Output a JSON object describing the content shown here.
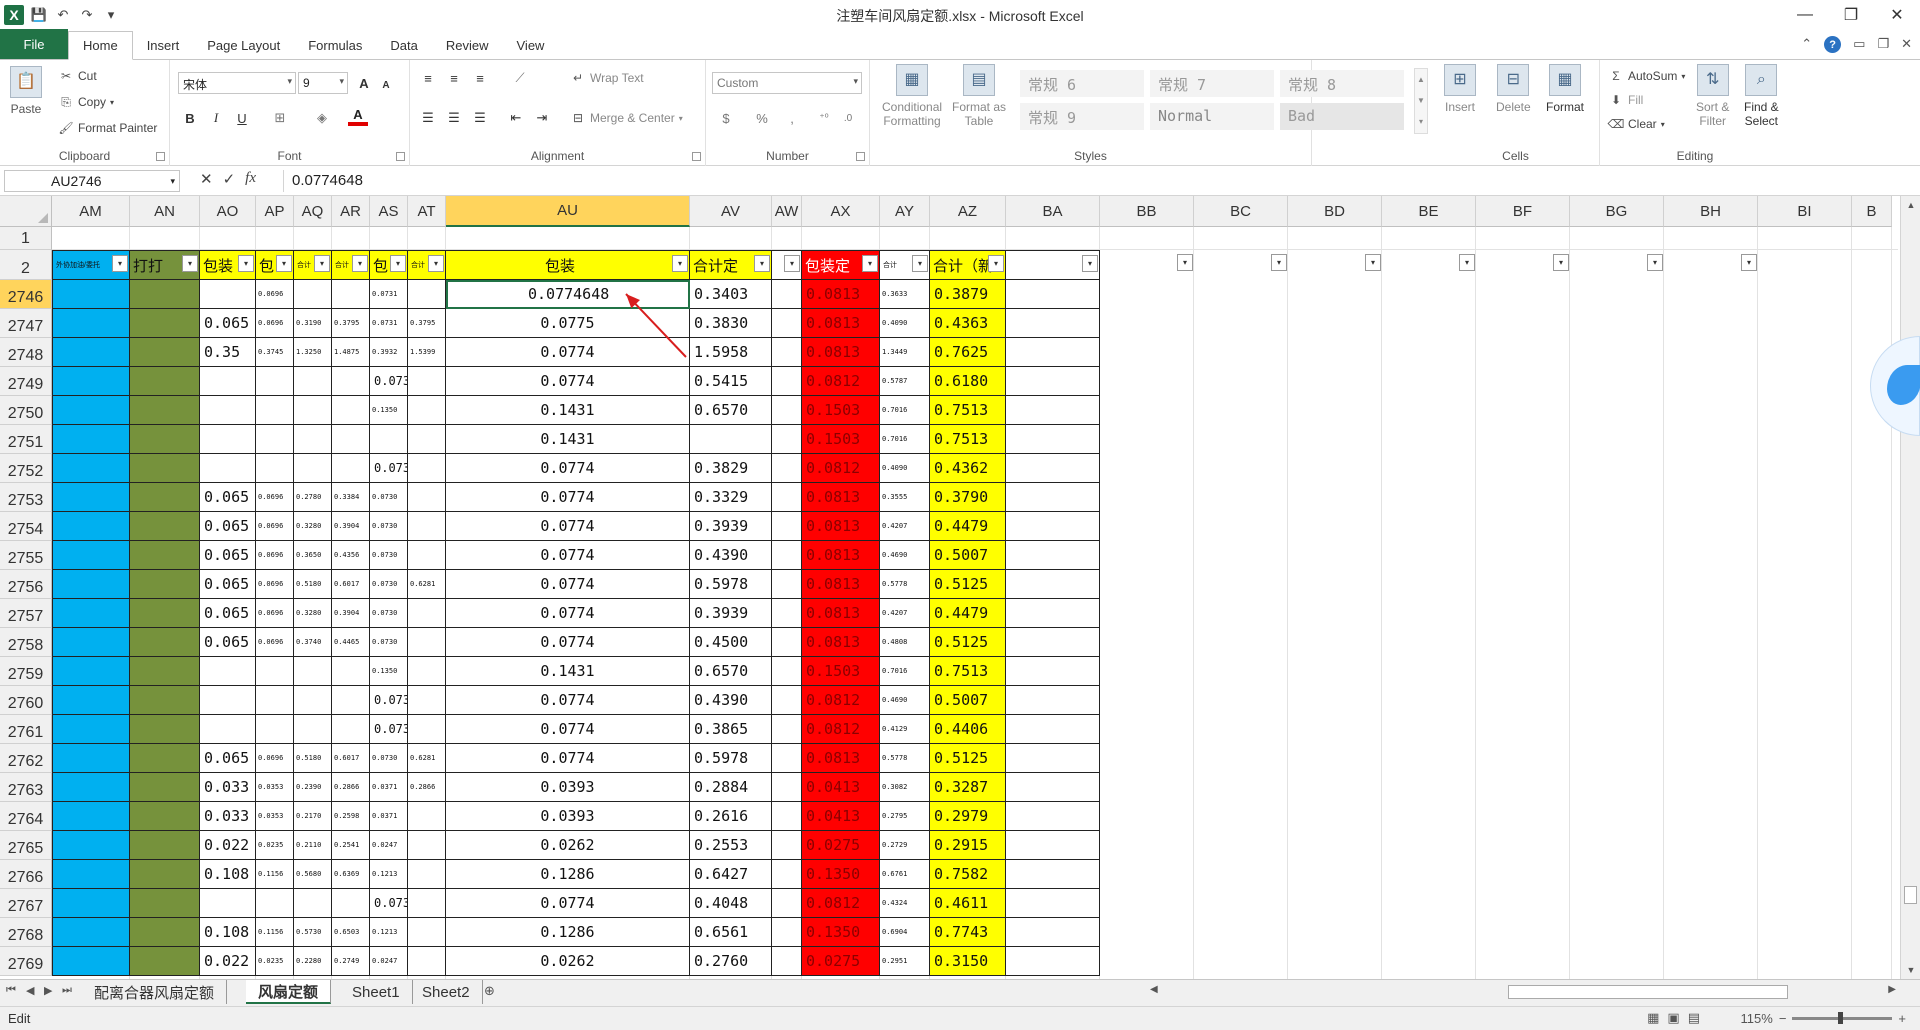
{
  "window": {
    "title": "注塑车间风扇定额.xlsx - Microsoft Excel",
    "minimize": "—",
    "restore": "❐",
    "close": "✕"
  },
  "tabs": [
    "File",
    "Home",
    "Insert",
    "Page Layout",
    "Formulas",
    "Data",
    "Review",
    "View"
  ],
  "active_tab": "Home",
  "ribbon": {
    "clipboard": {
      "label": "Clipboard",
      "paste": "Paste",
      "cut": "Cut",
      "copy": "Copy",
      "format_painter": "Format Painter"
    },
    "font": {
      "label": "Font",
      "name": "宋体",
      "size": "9",
      "bold": "B",
      "italic": "I",
      "underline": "U",
      "grow": "A",
      "shrink": "A"
    },
    "alignment": {
      "label": "Alignment",
      "wrap_text": "Wrap Text",
      "merge_center": "Merge & Center"
    },
    "number": {
      "label": "Number",
      "format": "Custom",
      "currency": "$",
      "percent": "%",
      "comma": ",",
      "inc_dec": "⁺⁰",
      "dec_dec": ".0"
    },
    "styles": {
      "label": "Styles",
      "conditional": [
        "Conditional",
        "Formatting"
      ],
      "format_as": [
        "Format as",
        "Table"
      ],
      "cells": [
        "常规 6",
        "常规 7",
        "常规 8",
        "常规 9",
        "Normal",
        "Bad"
      ]
    },
    "cells": {
      "label": "Cells",
      "insert": "Insert",
      "delete": "Delete",
      "format": "Format"
    },
    "editing": {
      "label": "Editing",
      "autosum": "AutoSum",
      "fill": "Fill",
      "clear": "Clear",
      "sort": [
        "Sort &",
        "Filter"
      ],
      "find": [
        "Find &",
        "Select"
      ]
    }
  },
  "formula_bar": {
    "name_box": "AU2746",
    "cancel": "✕",
    "enter": "✓",
    "fx": "fx",
    "value": "0.0774648"
  },
  "columns": [
    "AM",
    "AN",
    "AO",
    "AP",
    "AQ",
    "AR",
    "AS",
    "AT",
    "AU",
    "AV",
    "AW",
    "AX",
    "AY",
    "AZ",
    "BA",
    "BB",
    "BC",
    "BD",
    "BE",
    "BF",
    "BG",
    "BH",
    "BI",
    "B"
  ],
  "selected_column": "AU",
  "header_row": {
    "row1": "1",
    "row2": "2",
    "AM": "外协加油/委托",
    "AN": "打打",
    "AO": "包装",
    "AP": "包",
    "AQ": "合计",
    "AR": "合计",
    "AS": "包",
    "AT": "合计",
    "AU": "包装",
    "AV": "合计定",
    "AW": "",
    "AX": "包装定",
    "AY": "合计",
    "AZ": "合计（新",
    "BA": ""
  },
  "rows": [
    {
      "n": "2746",
      "AO": "",
      "AP": "0.0696",
      "AQ": "",
      "AR": "",
      "AS": "0.0731",
      "AT": "",
      "AU": "0.0774648",
      "AV": "0.3403",
      "AX": "0.0813",
      "AY": "0.3633",
      "AZ": "0.3879"
    },
    {
      "n": "2747",
      "AO": "0.065",
      "AP": "0.0696",
      "AQ": "0.3190",
      "AR": "0.3795",
      "AS": "0.0731",
      "AT": "0.3795",
      "AU": "0.0775",
      "AV": "0.3830",
      "AX": "0.0813",
      "AY": "0.4090",
      "AZ": "0.4363"
    },
    {
      "n": "2748",
      "AO": "0.35",
      "AP": "0.3745",
      "AQ": "1.3250",
      "AR": "1.4875",
      "AS": "0.3932",
      "AT": "1.5399",
      "AU": "0.0774",
      "AV": "1.5958",
      "AX": "0.0813",
      "AY": "1.3449",
      "AZ": "0.7625"
    },
    {
      "n": "2749",
      "AO": "",
      "AP": "",
      "AQ": "",
      "AR": "",
      "AS": "0.073",
      "AT": "",
      "AU": "0.0774",
      "AV": "0.5415",
      "AX": "0.0812",
      "AY": "0.5787",
      "AZ": "0.6180"
    },
    {
      "n": "2750",
      "AO": "",
      "AP": "",
      "AQ": "",
      "AR": "",
      "AS": "0.1350",
      "AT": "",
      "AU": "0.1431",
      "AV": "0.6570",
      "AX": "0.1503",
      "AY": "0.7016",
      "AZ": "0.7513"
    },
    {
      "n": "2751",
      "AO": "",
      "AP": "",
      "AQ": "",
      "AR": "",
      "AS": "",
      "AT": "",
      "AU": "0.1431",
      "AV": "",
      "AX": "0.1503",
      "AY": "0.7016",
      "AZ": "0.7513"
    },
    {
      "n": "2752",
      "AO": "",
      "AP": "",
      "AQ": "",
      "AR": "",
      "AS": "0.073",
      "AT": "",
      "AU": "0.0774",
      "AV": "0.3829",
      "AX": "0.0812",
      "AY": "0.4090",
      "AZ": "0.4362"
    },
    {
      "n": "2753",
      "AO": "0.065",
      "AP": "0.0696",
      "AQ": "0.2780",
      "AR": "0.3384",
      "AS": "0.0730",
      "AT": "",
      "AU": "0.0774",
      "AV": "0.3329",
      "AX": "0.0813",
      "AY": "0.3555",
      "AZ": "0.3790"
    },
    {
      "n": "2754",
      "AO": "0.065",
      "AP": "0.0696",
      "AQ": "0.3280",
      "AR": "0.3904",
      "AS": "0.0730",
      "AT": "",
      "AU": "0.0774",
      "AV": "0.3939",
      "AX": "0.0813",
      "AY": "0.4207",
      "AZ": "0.4479"
    },
    {
      "n": "2755",
      "AO": "0.065",
      "AP": "0.0696",
      "AQ": "0.3650",
      "AR": "0.4356",
      "AS": "0.0730",
      "AT": "",
      "AU": "0.0774",
      "AV": "0.4390",
      "AX": "0.0813",
      "AY": "0.4690",
      "AZ": "0.5007"
    },
    {
      "n": "2756",
      "AO": "0.065",
      "AP": "0.0696",
      "AQ": "0.5180",
      "AR": "0.6017",
      "AS": "0.0730",
      "AT": "0.6281",
      "AU": "0.0774",
      "AV": "0.5978",
      "AX": "0.0813",
      "AY": "0.5778",
      "AZ": "0.5125"
    },
    {
      "n": "2757",
      "AO": "0.065",
      "AP": "0.0696",
      "AQ": "0.3280",
      "AR": "0.3904",
      "AS": "0.0730",
      "AT": "",
      "AU": "0.0774",
      "AV": "0.3939",
      "AX": "0.0813",
      "AY": "0.4207",
      "AZ": "0.4479"
    },
    {
      "n": "2758",
      "AO": "0.065",
      "AP": "0.0696",
      "AQ": "0.3740",
      "AR": "0.4465",
      "AS": "0.0730",
      "AT": "",
      "AU": "0.0774",
      "AV": "0.4500",
      "AX": "0.0813",
      "AY": "0.4808",
      "AZ": "0.5125"
    },
    {
      "n": "2759",
      "AO": "",
      "AP": "",
      "AQ": "",
      "AR": "",
      "AS": "0.1350",
      "AT": "",
      "AU": "0.1431",
      "AV": "0.6570",
      "AX": "0.1503",
      "AY": "0.7016",
      "AZ": "0.7513"
    },
    {
      "n": "2760",
      "AO": "",
      "AP": "",
      "AQ": "",
      "AR": "",
      "AS": "0.073",
      "AT": "",
      "AU": "0.0774",
      "AV": "0.4390",
      "AX": "0.0812",
      "AY": "0.4690",
      "AZ": "0.5007"
    },
    {
      "n": "2761",
      "AO": "",
      "AP": "",
      "AQ": "",
      "AR": "",
      "AS": "0.073",
      "AT": "",
      "AU": "0.0774",
      "AV": "0.3865",
      "AX": "0.0812",
      "AY": "0.4129",
      "AZ": "0.4406"
    },
    {
      "n": "2762",
      "AO": "0.065",
      "AP": "0.0696",
      "AQ": "0.5180",
      "AR": "0.6017",
      "AS": "0.0730",
      "AT": "0.6281",
      "AU": "0.0774",
      "AV": "0.5978",
      "AX": "0.0813",
      "AY": "0.5778",
      "AZ": "0.5125"
    },
    {
      "n": "2763",
      "AO": "0.033",
      "AP": "0.0353",
      "AQ": "0.2390",
      "AR": "0.2866",
      "AS": "0.0371",
      "AT": "0.2866",
      "AU": "0.0393",
      "AV": "0.2884",
      "AX": "0.0413",
      "AY": "0.3082",
      "AZ": "0.3287"
    },
    {
      "n": "2764",
      "AO": "0.033",
      "AP": "0.0353",
      "AQ": "0.2170",
      "AR": "0.2598",
      "AS": "0.0371",
      "AT": "",
      "AU": "0.0393",
      "AV": "0.2616",
      "AX": "0.0413",
      "AY": "0.2795",
      "AZ": "0.2979"
    },
    {
      "n": "2765",
      "AO": "0.022",
      "AP": "0.0235",
      "AQ": "0.2110",
      "AR": "0.2541",
      "AS": "0.0247",
      "AT": "",
      "AU": "0.0262",
      "AV": "0.2553",
      "AX": "0.0275",
      "AY": "0.2729",
      "AZ": "0.2915"
    },
    {
      "n": "2766",
      "AO": "0.108",
      "AP": "0.1156",
      "AQ": "0.5680",
      "AR": "0.6369",
      "AS": "0.1213",
      "AT": "",
      "AU": "0.1286",
      "AV": "0.6427",
      "AX": "0.1350",
      "AY": "0.6761",
      "AZ": "0.7582"
    },
    {
      "n": "2767",
      "AO": "",
      "AP": "",
      "AQ": "",
      "AR": "",
      "AS": "0.073",
      "AT": "",
      "AU": "0.0774",
      "AV": "0.4048",
      "AX": "0.0812",
      "AY": "0.4324",
      "AZ": "0.4611"
    },
    {
      "n": "2768",
      "AO": "0.108",
      "AP": "0.1156",
      "AQ": "0.5730",
      "AR": "0.6503",
      "AS": "0.1213",
      "AT": "",
      "AU": "0.1286",
      "AV": "0.6561",
      "AX": "0.1350",
      "AY": "0.6904",
      "AZ": "0.7743"
    },
    {
      "n": "2769",
      "AO": "0.022",
      "AP": "0.0235",
      "AQ": "0.2280",
      "AR": "0.2749",
      "AS": "0.0247",
      "AT": "",
      "AU": "0.0262",
      "AV": "0.2760",
      "AX": "0.0275",
      "AY": "0.2951",
      "AZ": "0.3150"
    }
  ],
  "sheets": [
    "配离合器风扇定额",
    "风扇定额",
    "Sheet1",
    "Sheet2"
  ],
  "active_sheet": "风扇定额",
  "status": {
    "mode": "Edit",
    "zoom": "115%"
  },
  "colors": {
    "blue": "#00b0f0",
    "green": "#76923c",
    "yellow": "#ffff00",
    "red": "#ff0000",
    "excel_green": "#217346",
    "selected_header": "#ffd45c"
  }
}
